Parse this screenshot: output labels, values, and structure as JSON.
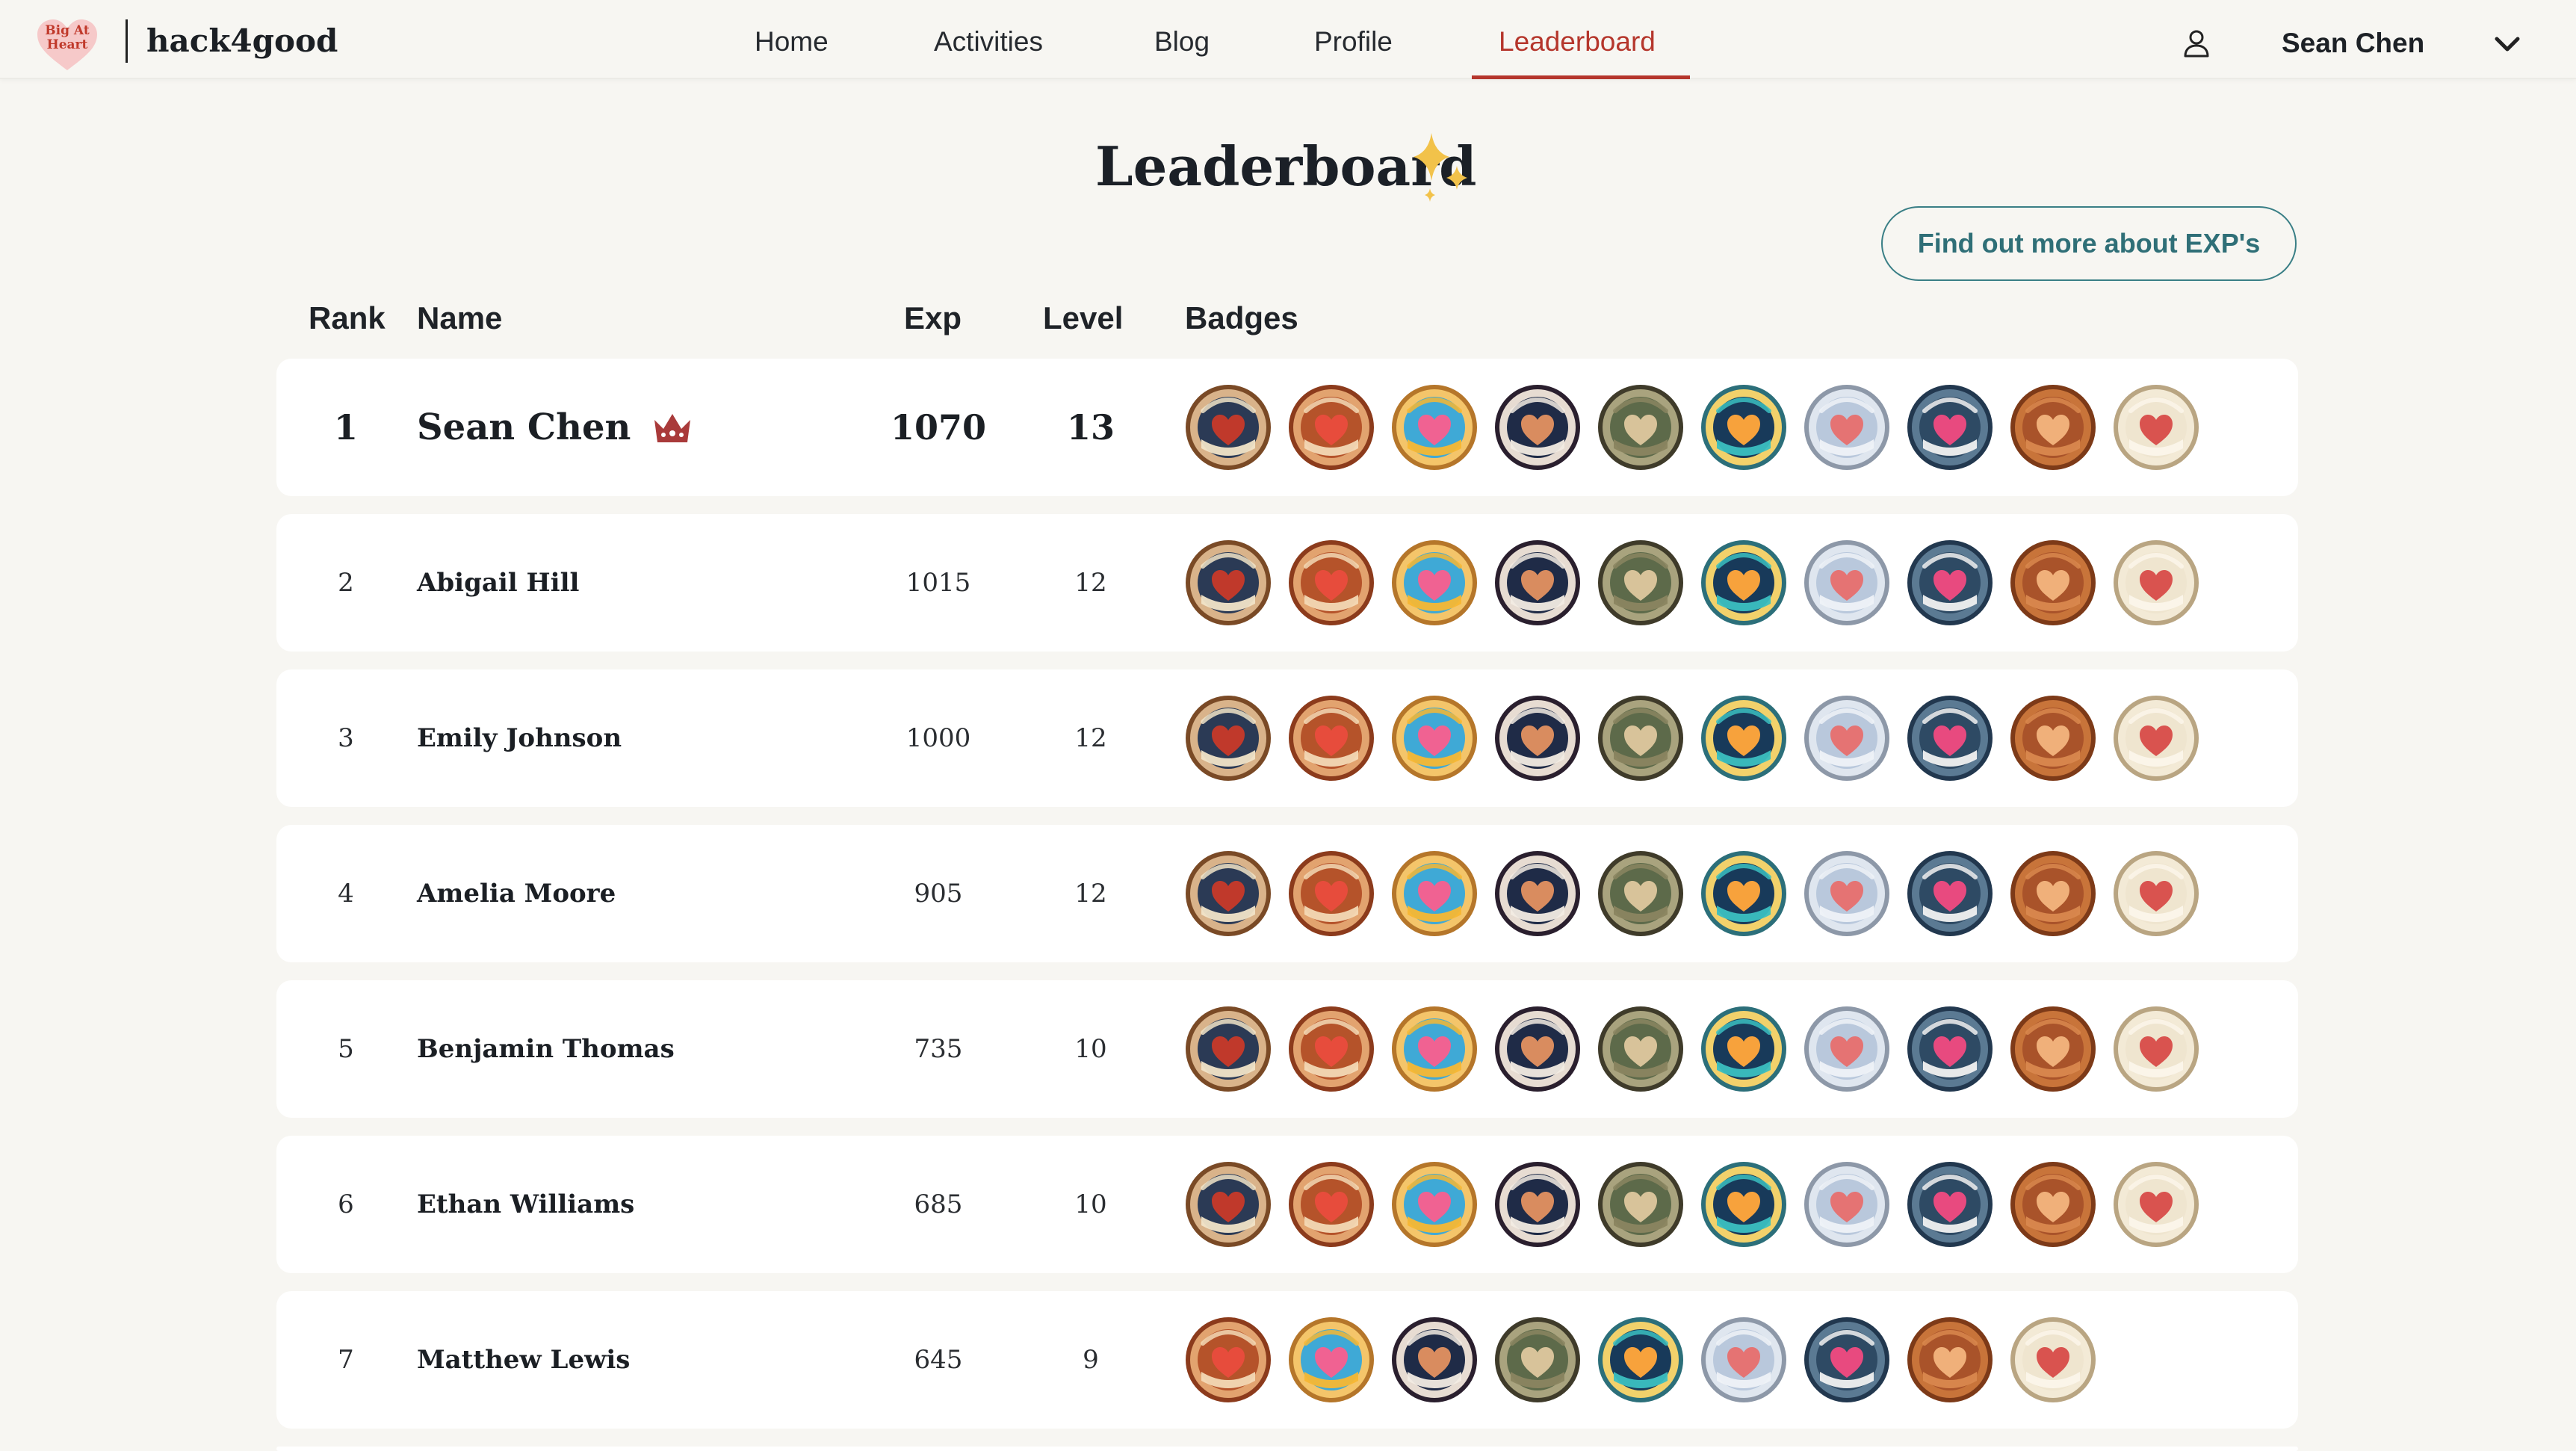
{
  "nav": {
    "logo_text": "Big At Heart",
    "brand": "hack4good",
    "items": [
      {
        "label": "Home",
        "active": false
      },
      {
        "label": "Activities",
        "active": false
      },
      {
        "label": "Blog",
        "active": false
      },
      {
        "label": "Profile",
        "active": false
      },
      {
        "label": "Leaderboard",
        "active": true
      }
    ],
    "user_name": "Sean Chen",
    "icons": {
      "user": "user-icon",
      "menu": "chevron-down-icon"
    }
  },
  "page": {
    "title": "Leaderboard",
    "exp_button": "Find out more about EXP's"
  },
  "table": {
    "headers": {
      "rank": "Rank",
      "name": "Name",
      "exp": "Exp",
      "level": "Level",
      "badges": "Badges"
    },
    "rows": [
      {
        "rank": "1",
        "name": "Sean Chen",
        "exp": "1070",
        "level": "13",
        "crown": true,
        "badges": [
          "champion",
          "warm-hearted",
          "joyful",
          "trailblazer",
          "kindness",
          "radiant",
          "empathy-level",
          "heartfelt-explorer",
          "gratitude",
          "tender-level"
        ]
      },
      {
        "rank": "2",
        "name": "Abigail Hill",
        "exp": "1015",
        "level": "12",
        "badges": [
          "champion",
          "warm-hearted",
          "joyful",
          "trailblazer",
          "kindness",
          "radiant",
          "empathy-level",
          "heartfelt-explorer",
          "gratitude",
          "tender-level"
        ]
      },
      {
        "rank": "3",
        "name": "Emily Johnson",
        "exp": "1000",
        "level": "12",
        "badges": [
          "champion",
          "warm-hearted",
          "joyful",
          "trailblazer",
          "kindness",
          "radiant",
          "empathy-level",
          "heartfelt-explorer",
          "gratitude",
          "tender-level"
        ]
      },
      {
        "rank": "4",
        "name": "Amelia Moore",
        "exp": "905",
        "level": "12",
        "badges": [
          "champion",
          "warm-hearted",
          "joyful",
          "trailblazer",
          "kindness",
          "radiant",
          "empathy-level",
          "heartfelt-explorer",
          "gratitude",
          "tender-level"
        ]
      },
      {
        "rank": "5",
        "name": "Benjamin Thomas",
        "exp": "735",
        "level": "10",
        "badges": [
          "champion",
          "warm-hearted",
          "joyful",
          "trailblazer",
          "kindness",
          "radiant",
          "empathy-level",
          "heartfelt-explorer",
          "gratitude",
          "tender-level"
        ]
      },
      {
        "rank": "6",
        "name": "Ethan Williams",
        "exp": "685",
        "level": "10",
        "badges": [
          "champion",
          "warm-hearted",
          "joyful",
          "trailblazer",
          "kindness",
          "radiant",
          "empathy-level",
          "heartfelt-explorer",
          "gratitude",
          "tender-level"
        ]
      },
      {
        "rank": "7",
        "name": "Matthew Lewis",
        "exp": "645",
        "level": "9",
        "badges": [
          "warm-hearted",
          "joyful",
          "trailblazer",
          "kindness",
          "radiant",
          "empathy-level",
          "heartfelt-explorer",
          "gratitude",
          "tender-level"
        ]
      }
    ]
  },
  "colors": {
    "accent": "#b5362c",
    "teal": "#3a7f86",
    "background": "#f7f6f2",
    "row_background": "#ffffff"
  }
}
